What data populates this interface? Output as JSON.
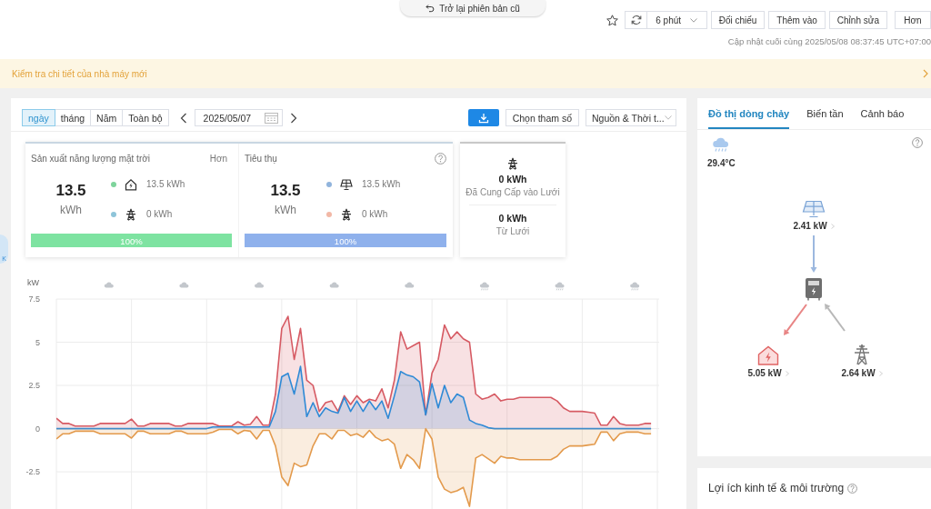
{
  "header": {
    "back_tab": "Trở lại phiên bản cũ",
    "refresh_interval": "6 phút",
    "buttons": [
      "Đối chiếu",
      "Thêm vào",
      "Chỉnh sửa",
      "Hơn"
    ],
    "last_updated": "Cập nhật cuối cùng 2025/05/08 08:37:45 UTC+07:00"
  },
  "notice": {
    "text": "Kiểm tra chi tiết của nhà máy mới"
  },
  "side_tab": {
    "label": "K"
  },
  "main": {
    "periods": [
      {
        "label": "ngày",
        "selected": true
      },
      {
        "label": "tháng",
        "selected": false
      },
      {
        "label": "Năm",
        "selected": false
      },
      {
        "label": "Toàn bộ",
        "selected": false
      }
    ],
    "date": "2025/05/07",
    "params_button": "Chọn tham số",
    "source_select": "Nguồn & Thời t...",
    "panels": [
      {
        "kind": "production",
        "title": "Sản xuất năng lượng mặt trời",
        "more": "Hơn",
        "total": "13.5",
        "unit": "kWh",
        "sources": [
          {
            "kind": "home",
            "color": "#7ed49c",
            "value": "13.5 kWh"
          },
          {
            "kind": "grid",
            "color": "#8ec4d9",
            "value": "0 kWh"
          }
        ],
        "bar": {
          "level": 1,
          "label": "100%"
        }
      },
      {
        "kind": "consumption",
        "title": "Tiêu thụ",
        "total": "13.5",
        "unit": "kWh",
        "sources": [
          {
            "kind": "solar",
            "color": "#91b4dc",
            "value": "13.5 kWh"
          },
          {
            "kind": "grid",
            "color": "#f2b8a6",
            "value": "0 kWh"
          }
        ],
        "bar": {
          "level": 1,
          "label": "100%"
        }
      }
    ],
    "grid_card": {
      "entries": [
        {
          "value": "0 kWh",
          "label": "Đã Cung Cấp vào Lưới"
        },
        {
          "value": "0 kWh",
          "label": "Từ Lưới"
        }
      ]
    },
    "chart": {
      "weather_icons": [
        {
          "kind": "cloudy"
        },
        {
          "kind": "cloudy"
        },
        {
          "kind": "cloudy"
        },
        {
          "kind": "cloudy"
        },
        {
          "kind": "cloudy"
        },
        {
          "kind": "rain"
        },
        {
          "kind": "rain"
        },
        {
          "kind": "rain"
        }
      ],
      "chart_data": {
        "type": "area",
        "ylabel": "kW",
        "grid": true,
        "ylim": [
          -4.6,
          7.5
        ],
        "yticks": [
          7.5,
          5,
          2.5,
          0,
          -2.5
        ],
        "series": [
          {
            "color": "#d65a63",
            "values": [
              0.6,
              0.3,
              0.3,
              0.15,
              0.15,
              0.15,
              0.15,
              0.3,
              0.3,
              0.3,
              0.3,
              0.3,
              0.55,
              0.15,
              0.15,
              0.3,
              0.3,
              0.3,
              0.3,
              0.15,
              0.15,
              0.3,
              0.3,
              0.3,
              0.3,
              0.3,
              0.15,
              0.15,
              0.15,
              0.4,
              0.2,
              0.25,
              0.7,
              0.2,
              0.2,
              2.0,
              5.8,
              6.5,
              4.0,
              5.8,
              2.8,
              2.5,
              1.0,
              1.5,
              1.6,
              1.0,
              1.9,
              1.4,
              1.9,
              1.5,
              1.7,
              1.6,
              2.3,
              1.2,
              2.8,
              5.6,
              4.6,
              4.8,
              5.0,
              0.8,
              3.2,
              4.0,
              6.0,
              5.2,
              5.6,
              5.2,
              5.0,
              2.0,
              1.7,
              1.8,
              2.0,
              1.6,
              1.7,
              1.7,
              1.8,
              1.8,
              1.8,
              1.8,
              1.8,
              1.8,
              1.6,
              1.2,
              1.0,
              1.0,
              1.0,
              0.95,
              0.9,
              0.2,
              0.2,
              0.7,
              0.3,
              0.2,
              0.2,
              0.2,
              0.3,
              0.3
            ]
          },
          {
            "color": "#2f8ad6",
            "values": [
              0,
              0,
              0,
              0,
              0,
              0,
              0,
              0,
              0,
              0,
              0,
              0,
              0,
              0,
              0,
              0,
              0,
              0,
              0,
              0,
              0,
              0,
              0,
              0,
              0,
              0.1,
              0.1,
              0.1,
              0.1,
              0.1,
              0.1,
              0.1,
              0.1,
              0.1,
              0.1,
              1.0,
              3.0,
              3.2,
              2.0,
              3.6,
              0.7,
              1.5,
              0.7,
              1.2,
              1.0,
              0.9,
              1.8,
              1.0,
              1.6,
              1.0,
              1.6,
              1.1,
              1.6,
              0.6,
              1.9,
              3.3,
              3.1,
              3.0,
              2.7,
              0.8,
              2.6,
              1.2,
              2.5,
              1.5,
              2.0,
              1.8,
              0.5,
              0.3,
              0.2,
              0.05,
              0,
              0,
              0,
              0,
              0,
              0,
              0,
              0,
              0,
              0,
              0,
              0,
              0,
              0,
              0,
              0,
              0,
              0,
              0,
              0,
              0,
              0,
              0,
              0,
              0,
              0
            ]
          },
          {
            "color": "#e39a4c",
            "values": [
              -0.6,
              -0.3,
              -0.3,
              -0.15,
              -0.15,
              -0.15,
              -0.15,
              -0.3,
              -0.3,
              -0.3,
              -0.3,
              -0.3,
              -0.55,
              -0.15,
              -0.15,
              -0.3,
              -0.3,
              -0.3,
              -0.3,
              -0.15,
              -0.15,
              -0.3,
              -0.3,
              -0.3,
              -0.3,
              -0.2,
              -0.05,
              -0.05,
              -0.05,
              -0.3,
              -0.1,
              -0.15,
              -0.6,
              -0.1,
              -0.1,
              -1.0,
              -2.8,
              -3.3,
              -2.0,
              -2.2,
              -2.1,
              -1.0,
              -0.3,
              -0.3,
              -0.6,
              -0.1,
              -0.1,
              -0.4,
              -0.3,
              -0.5,
              -0.1,
              -0.5,
              -0.7,
              -0.6,
              -0.9,
              -2.3,
              -1.5,
              -1.8,
              -2.3,
              0,
              -0.6,
              -2.8,
              -3.5,
              -3.7,
              -3.6,
              -3.4,
              -4.5,
              -1.7,
              -1.5,
              -1.75,
              -2.0,
              -1.6,
              -1.7,
              -1.7,
              -1.8,
              -1.8,
              -1.8,
              -1.8,
              -1.8,
              -1.8,
              -1.6,
              -1.2,
              -1.0,
              -1.0,
              -1.0,
              -0.95,
              -0.9,
              -0.2,
              -0.2,
              -0.7,
              -0.3,
              -0.2,
              -0.2,
              -0.2,
              -0.3,
              -0.3
            ]
          }
        ]
      }
    }
  },
  "flow_panel": {
    "tabs": [
      {
        "label": "Đồ thị dòng chảy",
        "selected": true
      },
      {
        "label": "Biến tần",
        "selected": false
      },
      {
        "label": "Cảnh báo",
        "selected": false
      }
    ],
    "weather": {
      "kind": "rain",
      "temperature": "29.4°C"
    },
    "nodes": [
      {
        "kind": "solar",
        "value": "2.41 kW"
      },
      {
        "kind": "inverter"
      },
      {
        "kind": "home",
        "value": "5.05 kW"
      },
      {
        "kind": "grid",
        "value": "2.64 kW"
      }
    ]
  },
  "benefits": {
    "title": "Lợi ích kinh tế & môi trường"
  }
}
